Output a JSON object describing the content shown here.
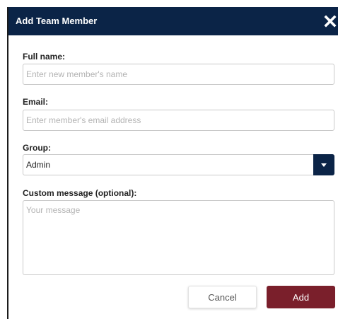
{
  "dialog": {
    "title": "Add Team Member",
    "close_icon": "close-icon",
    "header_color": "#0b2447"
  },
  "form": {
    "full_name": {
      "label": "Full name:",
      "value": "",
      "placeholder": "Enter new member's name"
    },
    "email": {
      "label": "Email:",
      "value": "",
      "placeholder": "Enter member's email address"
    },
    "group": {
      "label": "Group:",
      "selected": "Admin",
      "arrow_icon": "chevron-down-icon"
    },
    "message": {
      "label": "Custom message (optional):",
      "value": "",
      "placeholder": "Your message"
    }
  },
  "actions": {
    "cancel_label": "Cancel",
    "add_label": "Add",
    "add_color": "#7a1f2b"
  }
}
